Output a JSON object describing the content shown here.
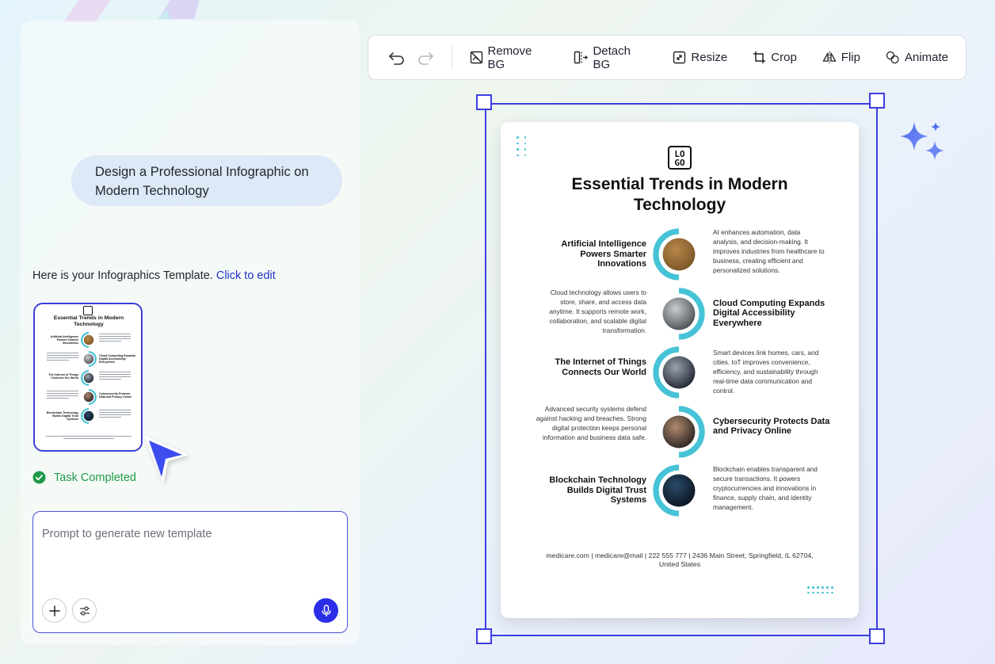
{
  "chat": {
    "user_prompt": "Design a Professional Infographic on Modern Technology",
    "reply_text": "Here is your Infographics Template.",
    "reply_link": "Click to edit",
    "task_status": "Task Completed",
    "prompt_placeholder": "Prompt to generate new template"
  },
  "toolbar": {
    "remove_bg": "Remove BG",
    "detach_bg": "Detach BG",
    "resize": "Resize",
    "crop": "Crop",
    "flip": "Flip",
    "animate": "Animate"
  },
  "poster": {
    "logo_top": "LO",
    "logo_bottom": "GO",
    "title": "Essential Trends in Modern Technology",
    "rows": [
      {
        "heading": "Artificial Intelligence Powers Smarter Innovations",
        "desc": "AI enhances automation, data analysis, and decision-making. It improves industries from healthcare to business, creating efficient and personalized solutions.",
        "image": "ai-circuit-image"
      },
      {
        "heading": "Cloud Computing Expands Digital Accessibility Everywhere",
        "desc": "Cloud technology allows users to store, share, and access data anytime. It supports remote work, collaboration, and scalable digital transformation.",
        "image": "cloud-image"
      },
      {
        "heading": "The Internet of Things Connects Our World",
        "desc": "Smart devices link homes, cars, and cities. IoT improves convenience, efficiency, and sustainability through real-time data communication and control.",
        "image": "iot-image"
      },
      {
        "heading": "Cybersecurity Protects Data and Privacy Online",
        "desc": "Advanced security systems defend against hacking and breaches. Strong digital protection keeps personal information and business data safe.",
        "image": "cybersecurity-image"
      },
      {
        "heading": "Blockchain Technology Builds Digital Trust Systems",
        "desc": "Blockchain enables transparent and secure transactions. It powers cryptocurrencies and innovations in finance, supply chain, and identity management.",
        "image": "blockchain-image"
      }
    ],
    "footer": "medicare.com | medicare@mail | 222 555 777 | 2436 Main Street, Springfield, IL 62704, United States"
  },
  "colors": {
    "accent": "#3b3fe0",
    "ring": "#46c3d6",
    "success": "#1f9a4a",
    "mic": "#2a2ee6"
  },
  "icons": [
    "undo-icon",
    "redo-icon",
    "remove-bg-icon",
    "detach-bg-icon",
    "resize-icon",
    "crop-icon",
    "flip-icon",
    "animate-icon",
    "check-circle-icon",
    "plus-icon",
    "sliders-icon",
    "mic-icon",
    "sparkle-icon",
    "cursor-arrow-icon"
  ]
}
